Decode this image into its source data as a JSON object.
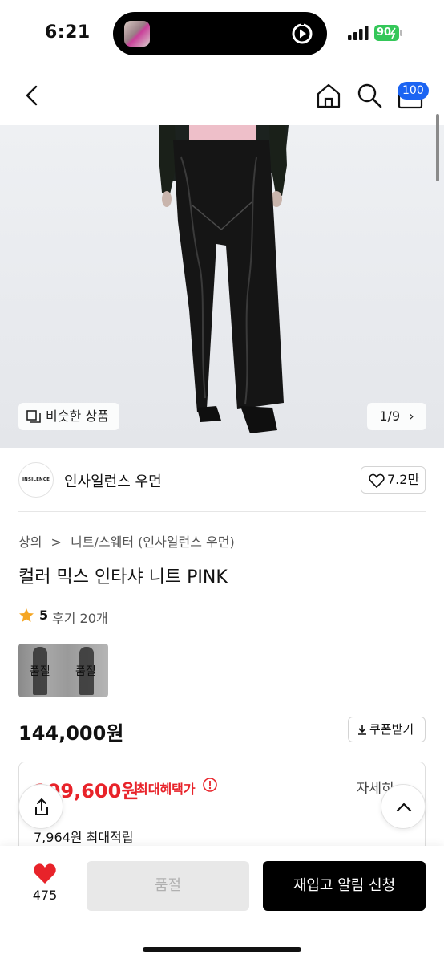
{
  "status_bar": {
    "time": "6:21",
    "battery": "90"
  },
  "nav": {
    "cart_count": "100"
  },
  "hero": {
    "similar_label": "비슷한 상품",
    "page_indicator": "1/9"
  },
  "brand": {
    "logo_text": "INSILENCE",
    "name": "인사일런스 우먼",
    "likes": "7.2만"
  },
  "breadcrumb": [
    "상의",
    ">",
    "니트/스웨터 (인사일런스 우먼)"
  ],
  "product": {
    "title": "컬러 믹스 인타샤 니트 PINK",
    "rating": "5",
    "reviews_label": "후기 20개",
    "option_badges": [
      "품절",
      "품절"
    ],
    "price": "144,000원",
    "coupon_label": "쿠폰받기"
  },
  "benefit": {
    "best_price": "109,600원",
    "best_label": "최대혜택가",
    "detail_label": "자세히",
    "points": "7,964원 최대적립"
  },
  "bottom": {
    "wish_count": "475",
    "soldout_label": "품절",
    "restock_label": "재입고 알림 신청"
  },
  "colors": {
    "accent_blue": "#1c64f2",
    "sale_red": "#e8232a",
    "star": "#f5a623",
    "battery_green": "#34c759"
  }
}
